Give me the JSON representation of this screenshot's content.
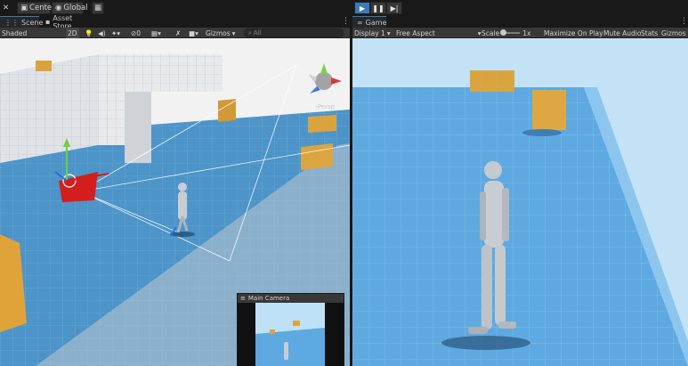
{
  "toolbar": {
    "pivot_label": "Center",
    "space_label": "Global",
    "play_icon": "play-icon",
    "pause_icon": "pause-icon",
    "step_icon": "step-icon"
  },
  "scene_panel": {
    "tabs": [
      {
        "label": "Scene",
        "icon": "grid-icon",
        "active": true
      },
      {
        "label": "Asset Store",
        "icon": "bag-icon",
        "active": false
      }
    ],
    "shading_mode": "Shaded",
    "mode_2d": "2D",
    "hidden_count": "0",
    "gizmos_label": "Gizmos",
    "search_placeholder": "All",
    "perspective_label": "‹Persp",
    "camera_preview_title": "Main Camera"
  },
  "game_panel": {
    "tab_label": "Game",
    "display": "Display 1",
    "aspect": "Free Aspect",
    "scale_label": "Scale",
    "scale_value": "1x",
    "maximize_label": "Maximize On Play",
    "mute_label": "Mute Audio",
    "stats_label": "Stats",
    "gizmos_label": "Gizmos"
  },
  "colors": {
    "accent": "#3a79bb",
    "floor": "#5da9e0",
    "box": "#e0a33a"
  }
}
